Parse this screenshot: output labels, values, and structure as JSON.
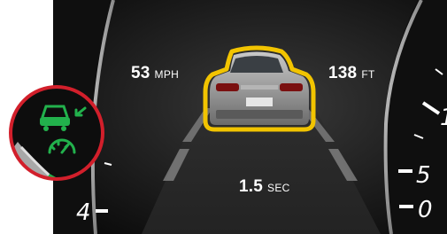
{
  "readouts": {
    "vehicle_speed": {
      "value": "53",
      "unit": "MPH"
    },
    "following_distance": {
      "value": "138",
      "unit": "FT"
    },
    "time_gap": {
      "value": "1.5",
      "unit": "SEC"
    }
  },
  "left_gauge": {
    "label_4": "4"
  },
  "right_gauge": {
    "label_5": "5",
    "label_0": "0",
    "label_1": "1"
  },
  "colors": {
    "lead_vehicle_highlight": "#f2c400",
    "assist_indicator_green": "#22b14c",
    "callout_ring_red": "#d21f2b",
    "cluster_background": "#161616"
  },
  "icons": [
    "distance-assist-indicator-icon",
    "lead-vehicle-icon"
  ]
}
